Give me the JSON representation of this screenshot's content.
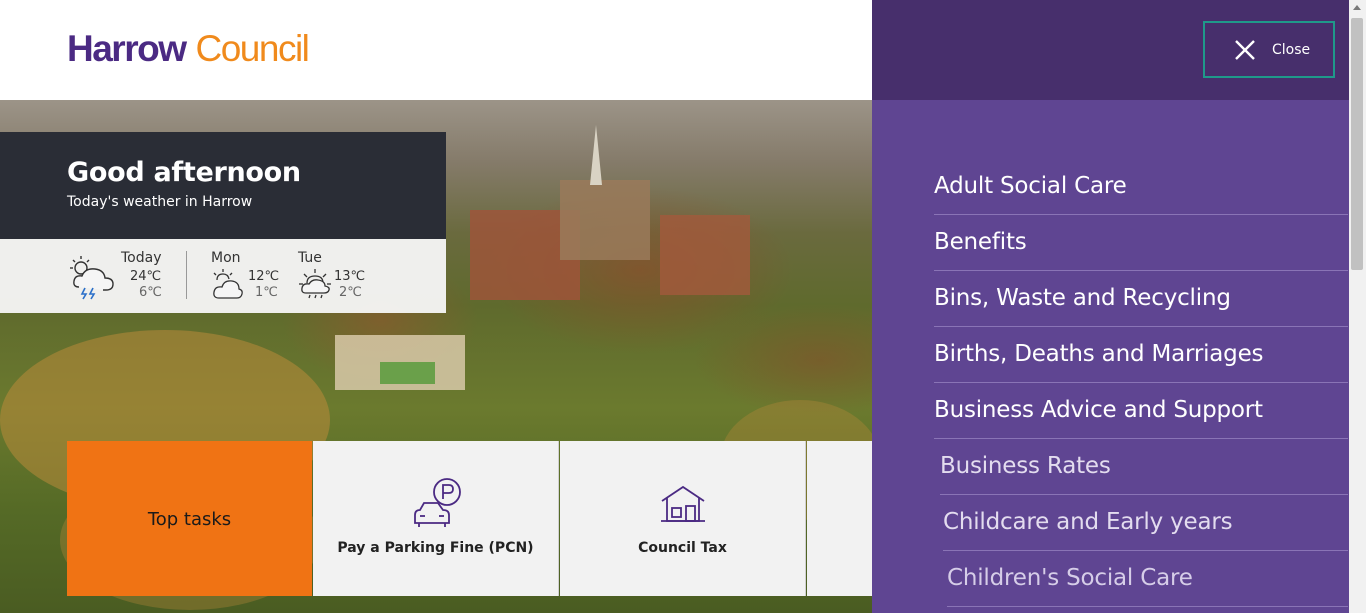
{
  "header": {
    "logo_primary": "Harrow",
    "logo_secondary": "Council"
  },
  "greeting": {
    "title": "Good afternoon",
    "subtitle": "Today's weather in Harrow"
  },
  "weather": [
    {
      "day": "Today",
      "high": "24℃",
      "low": "6℃",
      "icon": "thunderstorm-icon"
    },
    {
      "day": "Mon",
      "high": "12℃",
      "low": "1℃",
      "icon": "partly-cloudy-icon"
    },
    {
      "day": "Tue",
      "high": "13℃",
      "low": "2℃",
      "icon": "sun-cloud-rain-icon"
    }
  ],
  "tasks": {
    "heading": "Top tasks",
    "items": [
      {
        "label": "Pay a Parking Fine (PCN)",
        "icon": "parking-car-icon"
      },
      {
        "label": "Council Tax",
        "icon": "house-icon"
      }
    ]
  },
  "menu": {
    "close_label": "Close",
    "items": [
      "Adult Social Care",
      "Benefits",
      "Bins, Waste and Recycling",
      "Births, Deaths and Marriages",
      "Business Advice and Support",
      "Business Rates",
      "Childcare and Early years",
      "Children's Social Care"
    ]
  },
  "colors": {
    "brand_purple": "#4b2a83",
    "brand_orange": "#f08a1c",
    "menu_bg": "#5f4592",
    "menu_header": "#472f6c",
    "tasks_orange": "#f07314",
    "close_border": "#1f9a8a"
  }
}
